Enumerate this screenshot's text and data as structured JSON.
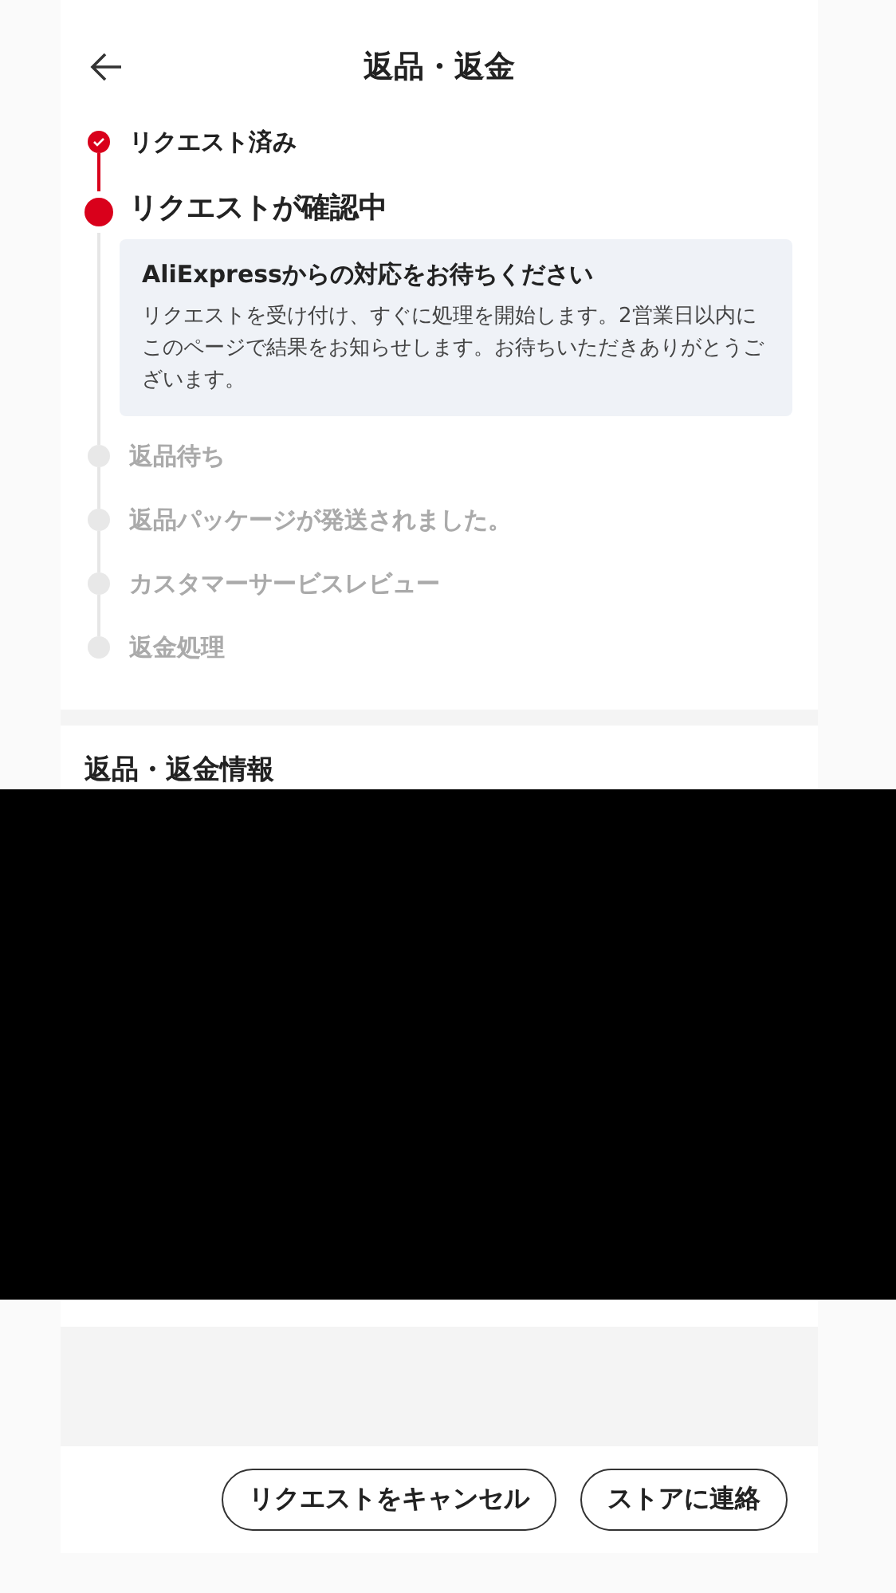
{
  "header": {
    "title": "返品・返金"
  },
  "steps": [
    {
      "label": "リクエスト済み",
      "kind": "done"
    },
    {
      "label": "リクエストが確認中",
      "kind": "current",
      "notice": {
        "title": "AliExpressからの対応をお待ちください",
        "body": "リクエストを受け付け、すぐに処理を開始します。2営業日以内にこのページで結果をお知らせします。お待ちいただきありがとうございます。"
      }
    },
    {
      "label": "返品待ち",
      "kind": "pending"
    },
    {
      "label": "返品パッケージが発送されました。",
      "kind": "pending"
    },
    {
      "label": "カスタマーサービスレビュー",
      "kind": "pending"
    },
    {
      "label": "返金処理",
      "kind": "pending"
    }
  ],
  "info_section": {
    "title": "返品・返金情報"
  },
  "buttons": [
    "リクエストをキャンセル",
    "ストアに連絡"
  ]
}
